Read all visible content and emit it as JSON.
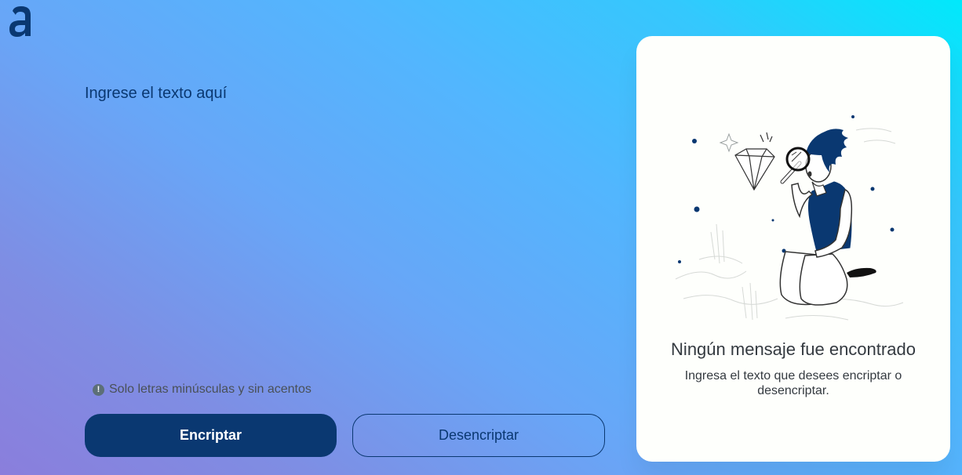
{
  "brand": {
    "logo_icon": "alura-a-logo-icon",
    "color": "#0a3871"
  },
  "editor": {
    "placeholder": "Ingrese el texto aquí",
    "value": ""
  },
  "hint": {
    "icon": "info-circle-icon",
    "text": "Solo letras minúsculas y sin acentos"
  },
  "buttons": {
    "encrypt_label": "Encriptar",
    "decrypt_label": "Desencriptar"
  },
  "output": {
    "illustration": "person-with-magnifying-glass-diamond-illustration",
    "title": "Ningún mensaje fue encontrado",
    "text": "Ingresa el texto que desees encriptar o desencriptar."
  },
  "colors": {
    "primary": "#0a3871",
    "card_bg": "#fefffc",
    "gradient_start": "#00e9fb",
    "gradient_end": "#8a7edc"
  }
}
